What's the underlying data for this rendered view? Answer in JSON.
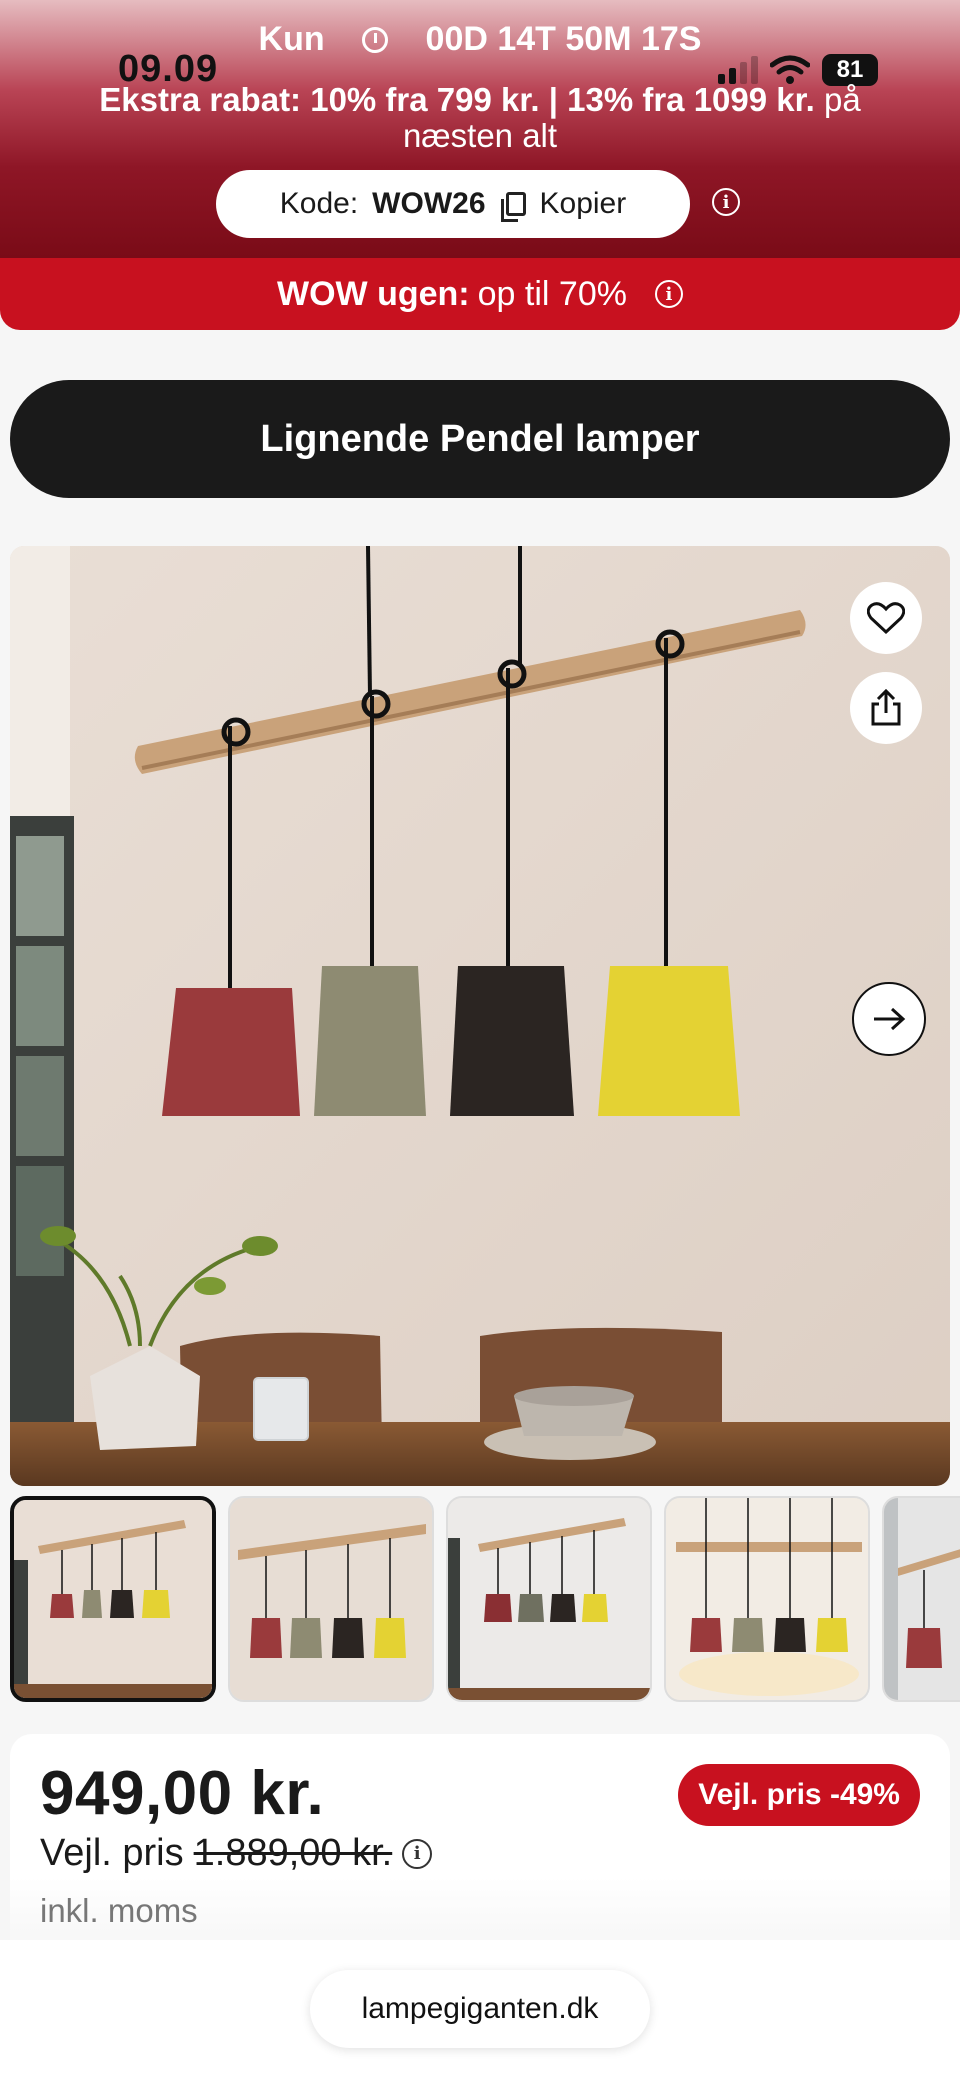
{
  "status_bar": {
    "time": "09.09",
    "battery": "81"
  },
  "promo": {
    "countdown_prefix": "Kun",
    "countdown_value": "00D 14T 50M 17S",
    "extra_bold": "Ekstra rabat: 10% fra 799 kr. | 13% fra 1099 kr.",
    "extra_rest": " på næsten alt",
    "code_label": "Kode:",
    "code_value": "WOW26",
    "copy_label": "Kopier"
  },
  "wow_banner": {
    "bold": "WOW ugen:",
    "rest": "op til 70%"
  },
  "similar_button": "Lignende Pendel lamper",
  "gallery": {
    "thumbnail_count_visible": 5,
    "active_index": 0
  },
  "price": {
    "current": "949,00 kr.",
    "badge": "Vejl. pris -49%",
    "rrp_label": "Vejl. pris",
    "rrp_value": "1.889,00 kr.",
    "vat_note": "inkl. moms"
  },
  "browser": {
    "url": "lampegiganten.dk"
  },
  "colors": {
    "accent_red": "#c8111f",
    "dark": "#1a1a1a",
    "promo_dark": "#7a0b17"
  }
}
